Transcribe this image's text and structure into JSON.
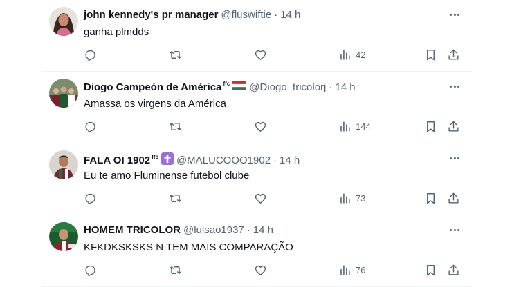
{
  "tweets": [
    {
      "name": "john kennedy's pr manager",
      "badge": "",
      "emoji": "",
      "handle": "@fluswiftie",
      "dot": "·",
      "time": "14 h",
      "text": "ganha plmdds",
      "views": "42",
      "avatar_colors": [
        "#3a2620",
        "#c98872"
      ]
    },
    {
      "name": "Diogo Campeón de América",
      "badge": "ffc",
      "emoji": "flag-hungary",
      "handle": "@Diogo_tricolorj",
      "dot": "·",
      "time": "14 h",
      "text": "Amassa os virgens da América",
      "views": "144",
      "avatar_colors": [
        "#5b3a3a",
        "#7e8b6d"
      ]
    },
    {
      "name": "FALA OI 1902",
      "badge": "ffc",
      "emoji": "latin-cross-emoji",
      "handle": "@MALUCOOO1902",
      "dot": "·",
      "time": "14 h",
      "text": "Eu te amo Fluminense futebol clube",
      "views": "73",
      "avatar_colors": [
        "#6e2b35",
        "#2e6b3c"
      ]
    },
    {
      "name": "HOMEM TRICOLOR",
      "badge": "",
      "emoji": "",
      "handle": "@luisao1937",
      "dot": "·",
      "time": "14 h",
      "text": "KFKDKSKSKS N TEM MAIS COMPARAÇÃO",
      "views": "76",
      "avatar_colors": [
        "#1f5a2e",
        "#8a2431"
      ]
    }
  ],
  "colors": {
    "text": "#0f1419",
    "secondary": "#536471",
    "divider": "#eff3f4"
  }
}
